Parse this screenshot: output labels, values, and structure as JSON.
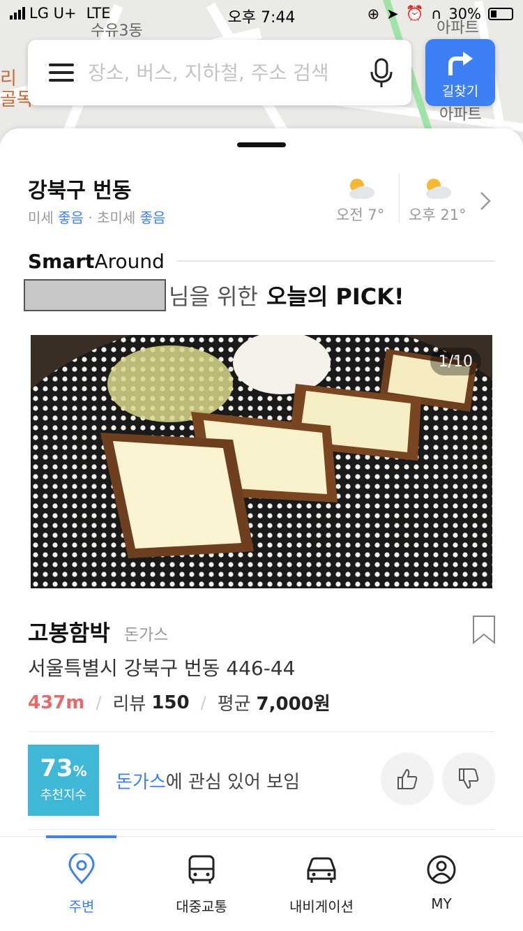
{
  "status_bar": {
    "carrier": "LG U+",
    "network": "LTE",
    "time": "오후 7:44",
    "battery": "30%"
  },
  "map": {
    "labels": [
      "수유3동",
      "아파트",
      "아파트"
    ],
    "left_labels": [
      "리",
      "골목"
    ]
  },
  "search": {
    "placeholder": "장소, 버스, 지하철, 주소 검색"
  },
  "directions": {
    "label": "길찾기"
  },
  "location": {
    "title": "강북구 번동",
    "air_fine_label": "미세",
    "air_fine_value": "좋음",
    "air_ultrafine_label": "· 초미세",
    "air_ultrafine_value": "좋음"
  },
  "weather": [
    {
      "time_label": "오전",
      "temp": "7°"
    },
    {
      "time_label": "오후",
      "temp": "21°"
    }
  ],
  "smart_around": {
    "brand_bold": "Smart",
    "brand_regular": "Around",
    "pick_suffix": "님을 위한",
    "pick_highlight": "오늘의 PICK!"
  },
  "card": {
    "image_counter": "1/10",
    "name": "고봉함박",
    "category": "돈가스",
    "address": "서울특별시 강북구 번동 446-44",
    "distance": "437m",
    "review_label": "리뷰",
    "review_count": "150",
    "avg_label": "평균",
    "avg_price": "7,000원",
    "score_value": "73",
    "score_unit": "%",
    "score_label": "추천지수",
    "interest_keyword": "돈가스",
    "interest_text": "에 관심 있어 보임"
  },
  "tabs": [
    {
      "label": "주변",
      "icon": "location-pin-icon",
      "active": true
    },
    {
      "label": "대중교통",
      "icon": "bus-icon",
      "active": false
    },
    {
      "label": "내비게이션",
      "icon": "car-icon",
      "active": false
    },
    {
      "label": "MY",
      "icon": "user-icon",
      "active": false
    }
  ],
  "colors": {
    "accent": "#3d7ff5",
    "distance": "#e66a6a",
    "score_bg": "#3fb8d8"
  }
}
